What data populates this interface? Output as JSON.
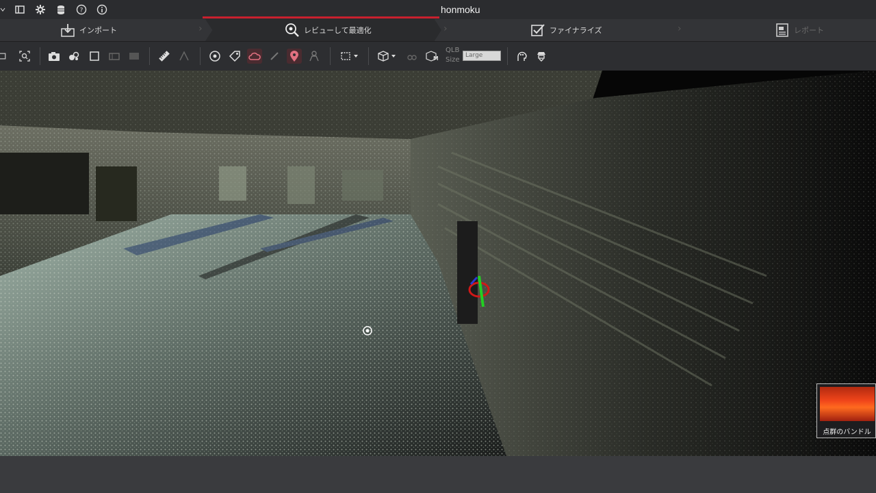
{
  "app": {
    "title": "honmoku"
  },
  "quick_icons": [
    "menu-icon",
    "window-icon",
    "gear-icon",
    "database-icon",
    "help-icon",
    "info-icon"
  ],
  "steps": [
    {
      "label": "インポート",
      "icon": "import-icon"
    },
    {
      "label": "レビューして最適化",
      "icon": "review-zoom-icon",
      "active": true
    },
    {
      "label": "ファイナライズ",
      "icon": "checkbox-icon"
    },
    {
      "label": "レポート",
      "icon": "report-icon"
    }
  ],
  "toolbar": {
    "qlb_label_1": "QLB",
    "qlb_label_2": "Size",
    "qlb_value": "Large"
  },
  "thumbnail": {
    "caption": "点群のバンドル"
  },
  "colors": {
    "accent": "#c8202e",
    "background": "#3a3b3e",
    "toolbar": "#2d2e31"
  }
}
